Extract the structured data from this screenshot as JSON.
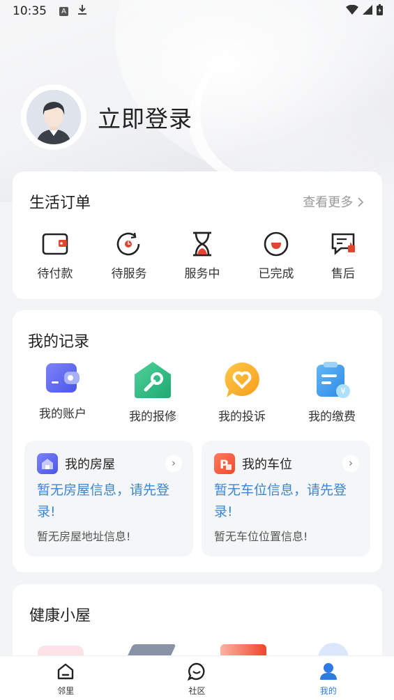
{
  "status_bar": {
    "time": "10:35"
  },
  "profile": {
    "login_text": "立即登录"
  },
  "orders": {
    "title": "生活订单",
    "more": "查看更多",
    "items": [
      {
        "label": "待付款",
        "icon": "wallet-icon"
      },
      {
        "label": "待服务",
        "icon": "service-pending-icon"
      },
      {
        "label": "服务中",
        "icon": "hourglass-icon"
      },
      {
        "label": "已完成",
        "icon": "completed-icon"
      },
      {
        "label": "售后",
        "icon": "after-sales-icon"
      }
    ]
  },
  "records": {
    "title": "我的记录",
    "items": [
      {
        "label": "我的账户",
        "icon": "account-wallet-icon"
      },
      {
        "label": "我的报修",
        "icon": "repair-wrench-icon"
      },
      {
        "label": "我的投诉",
        "icon": "complaint-heart-icon"
      },
      {
        "label": "我的缴费",
        "icon": "payment-clipboard-icon"
      }
    ],
    "house": {
      "title": "我的房屋",
      "message": "暂无房屋信息，请先登录!",
      "sub": "暂无房屋地址信息!"
    },
    "parking": {
      "title": "我的车位",
      "message": "暂无车位信息，请先登录!",
      "sub": "暂无车位位置信息!"
    }
  },
  "health": {
    "title": "健康小屋"
  },
  "bottom_nav": [
    {
      "label": "邻里",
      "icon": "home-icon"
    },
    {
      "label": "社区",
      "icon": "chat-icon"
    },
    {
      "label": "我的",
      "icon": "profile-icon",
      "active": true
    }
  ],
  "colors": {
    "accent": "#2f7be5",
    "link_blue": "#3a86d6",
    "order_red": "#e2452f"
  }
}
